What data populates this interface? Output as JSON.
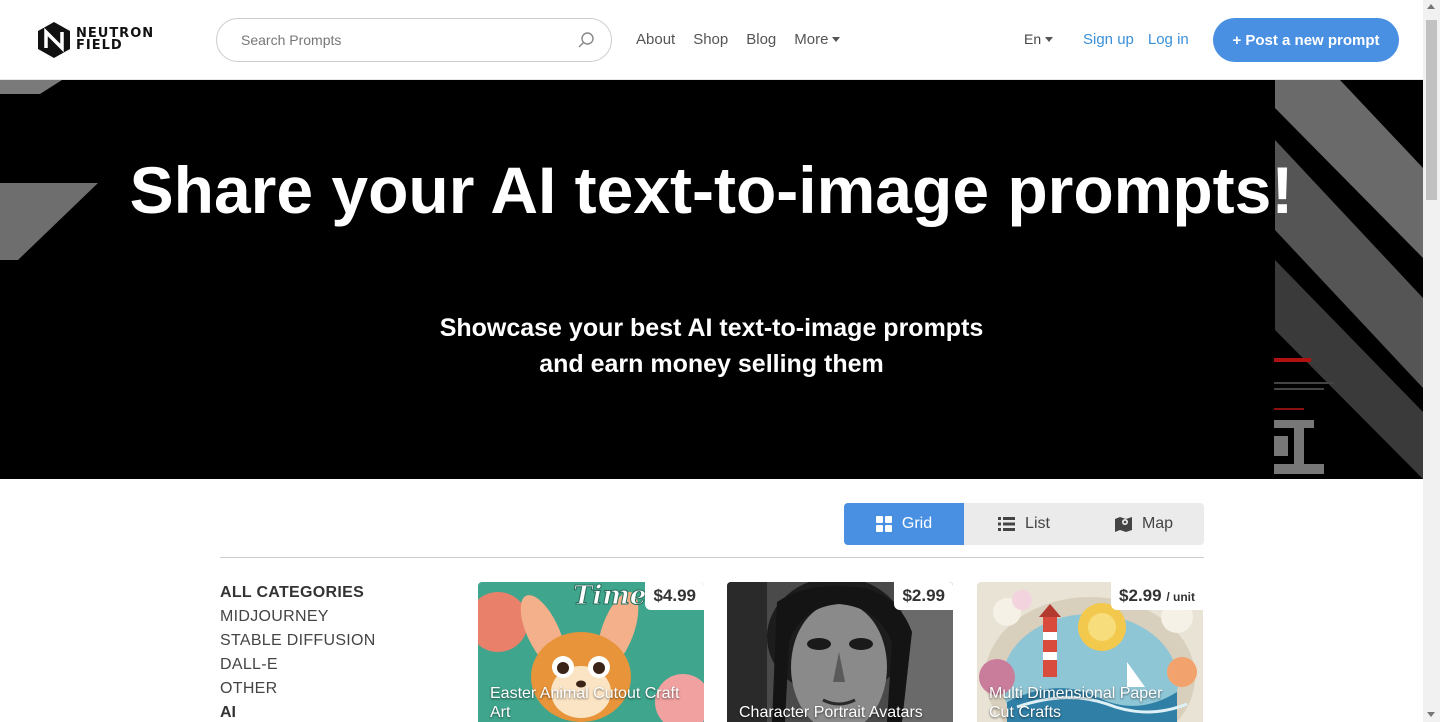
{
  "header": {
    "logo_line1": "NEUTRON",
    "logo_line2": "FIELD",
    "search_placeholder": "Search Prompts",
    "nav": [
      "About",
      "Shop",
      "Blog",
      "More"
    ],
    "lang": "En",
    "signup": "Sign up",
    "login": "Log in",
    "post_button": "+ Post a new prompt"
  },
  "hero": {
    "title": "Share your AI text-to-image prompts!",
    "subtitle_line1": "Showcase your best AI text-to-image prompts",
    "subtitle_line2": "and earn money selling them"
  },
  "view_toggle": {
    "options": [
      "Grid",
      "List",
      "Map"
    ],
    "active": "Grid"
  },
  "categories": {
    "items": [
      "ALL CATEGORIES",
      "MIDJOURNEY",
      "STABLE DIFFUSION",
      "DALL-E",
      "OTHER"
    ],
    "next_section_partial": "AI"
  },
  "cards": [
    {
      "title": "Easter Animal Cutout Craft Art",
      "price": "$4.99",
      "unit": "",
      "image_text": "Time"
    },
    {
      "title": "Character Portrait Avatars",
      "price": "$2.99",
      "unit": ""
    },
    {
      "title": "Multi Dimensional Paper Cut Crafts",
      "price": "$2.99",
      "unit": "/ unit"
    }
  ],
  "colors": {
    "accent": "#4a90e2",
    "link": "#3a8fd8",
    "hero_bg": "#000000"
  }
}
